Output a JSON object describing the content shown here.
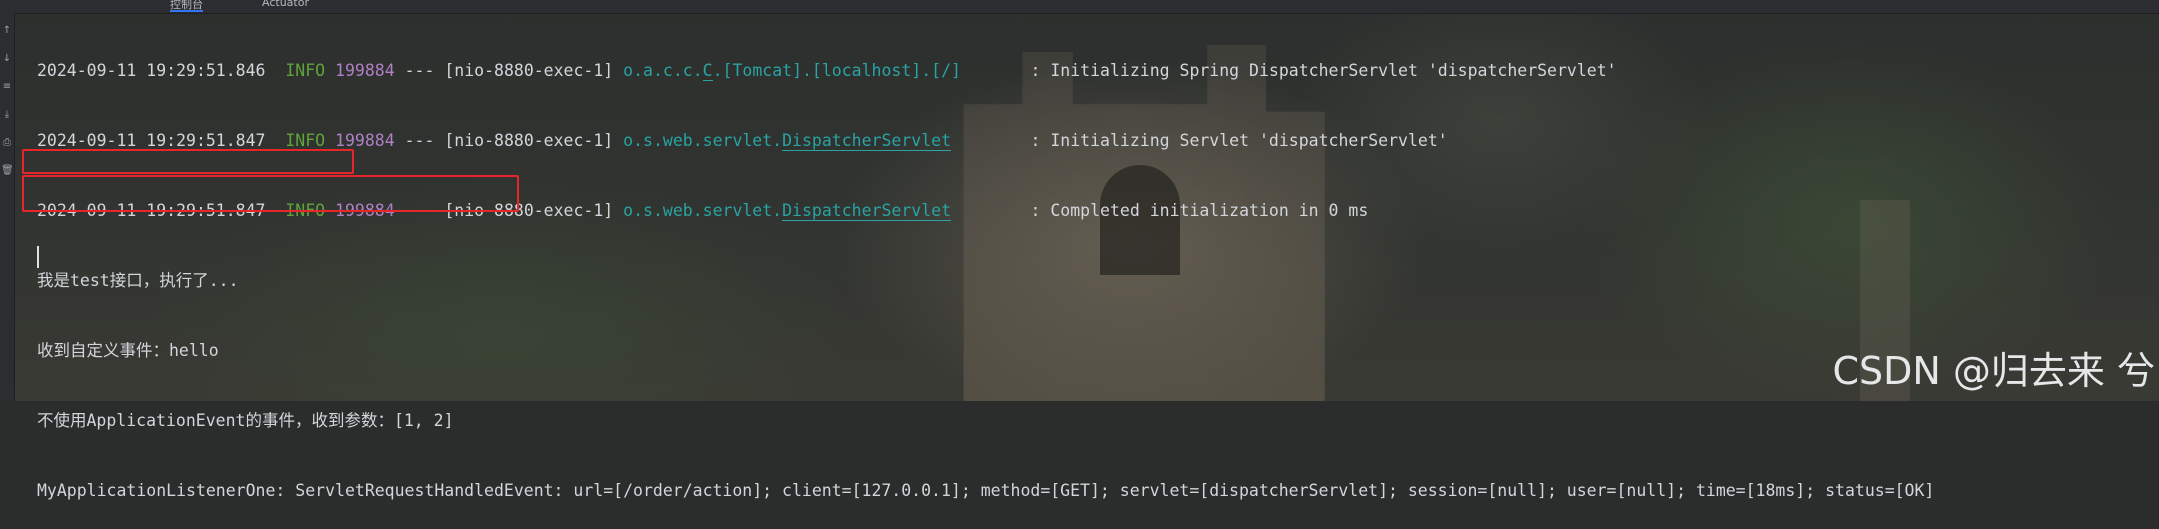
{
  "topbar": {
    "tabs": [
      {
        "label": "控制台",
        "active": true
      },
      {
        "label": "Actuator",
        "active": false
      }
    ]
  },
  "log_lines": [
    {
      "timestamp": "2024-09-11 19:29:51.846",
      "level": "INFO",
      "pid": "199884",
      "sep": "---",
      "thread": "[nio-8880-exec-1]",
      "logger_prefix": "o.a.c.c.",
      "logger_underlined": "C",
      "logger_suffix": ".[Tomcat].[localhost].[/]",
      "message": ": Initializing Spring DispatcherServlet 'dispatcherServlet'"
    },
    {
      "timestamp": "2024-09-11 19:29:51.847",
      "level": "INFO",
      "pid": "199884",
      "sep": "---",
      "thread": "[nio-8880-exec-1]",
      "logger_prefix": "o.s.web.servlet.",
      "logger_underlined": "DispatcherServlet",
      "logger_suffix": "",
      "message": ": Initializing Servlet 'dispatcherServlet'"
    },
    {
      "timestamp": "2024-09-11 19:29:51.847",
      "level": "INFO",
      "pid": "199884",
      "sep": "---",
      "thread": "[nio-8880-exec-1]",
      "logger_prefix": "o.s.web.servlet.",
      "logger_underlined": "DispatcherServlet",
      "logger_suffix": "",
      "message": ": Completed initialization in 0 ms"
    }
  ],
  "plain_lines": [
    "我是test接口，执行了...",
    "收到自定义事件：hello",
    "不使用ApplicationEvent的事件，收到参数：[1, 2]",
    "MyApplicationListenerOne: ServletRequestHandledEvent: url=[/order/action]; client=[127.0.0.1]; method=[GET]; servlet=[dispatcherServlet]; session=[null]; user=[null]; time=[18ms]; status=[OK]"
  ],
  "gutter_icons": [
    "arrow-up-icon",
    "arrow-down-icon",
    "soft-wrap-icon",
    "scroll-to-end-icon",
    "print-icon",
    "trash-icon"
  ],
  "highlight_color": "#e8262a",
  "watermark": "CSDN @归去来 兮"
}
